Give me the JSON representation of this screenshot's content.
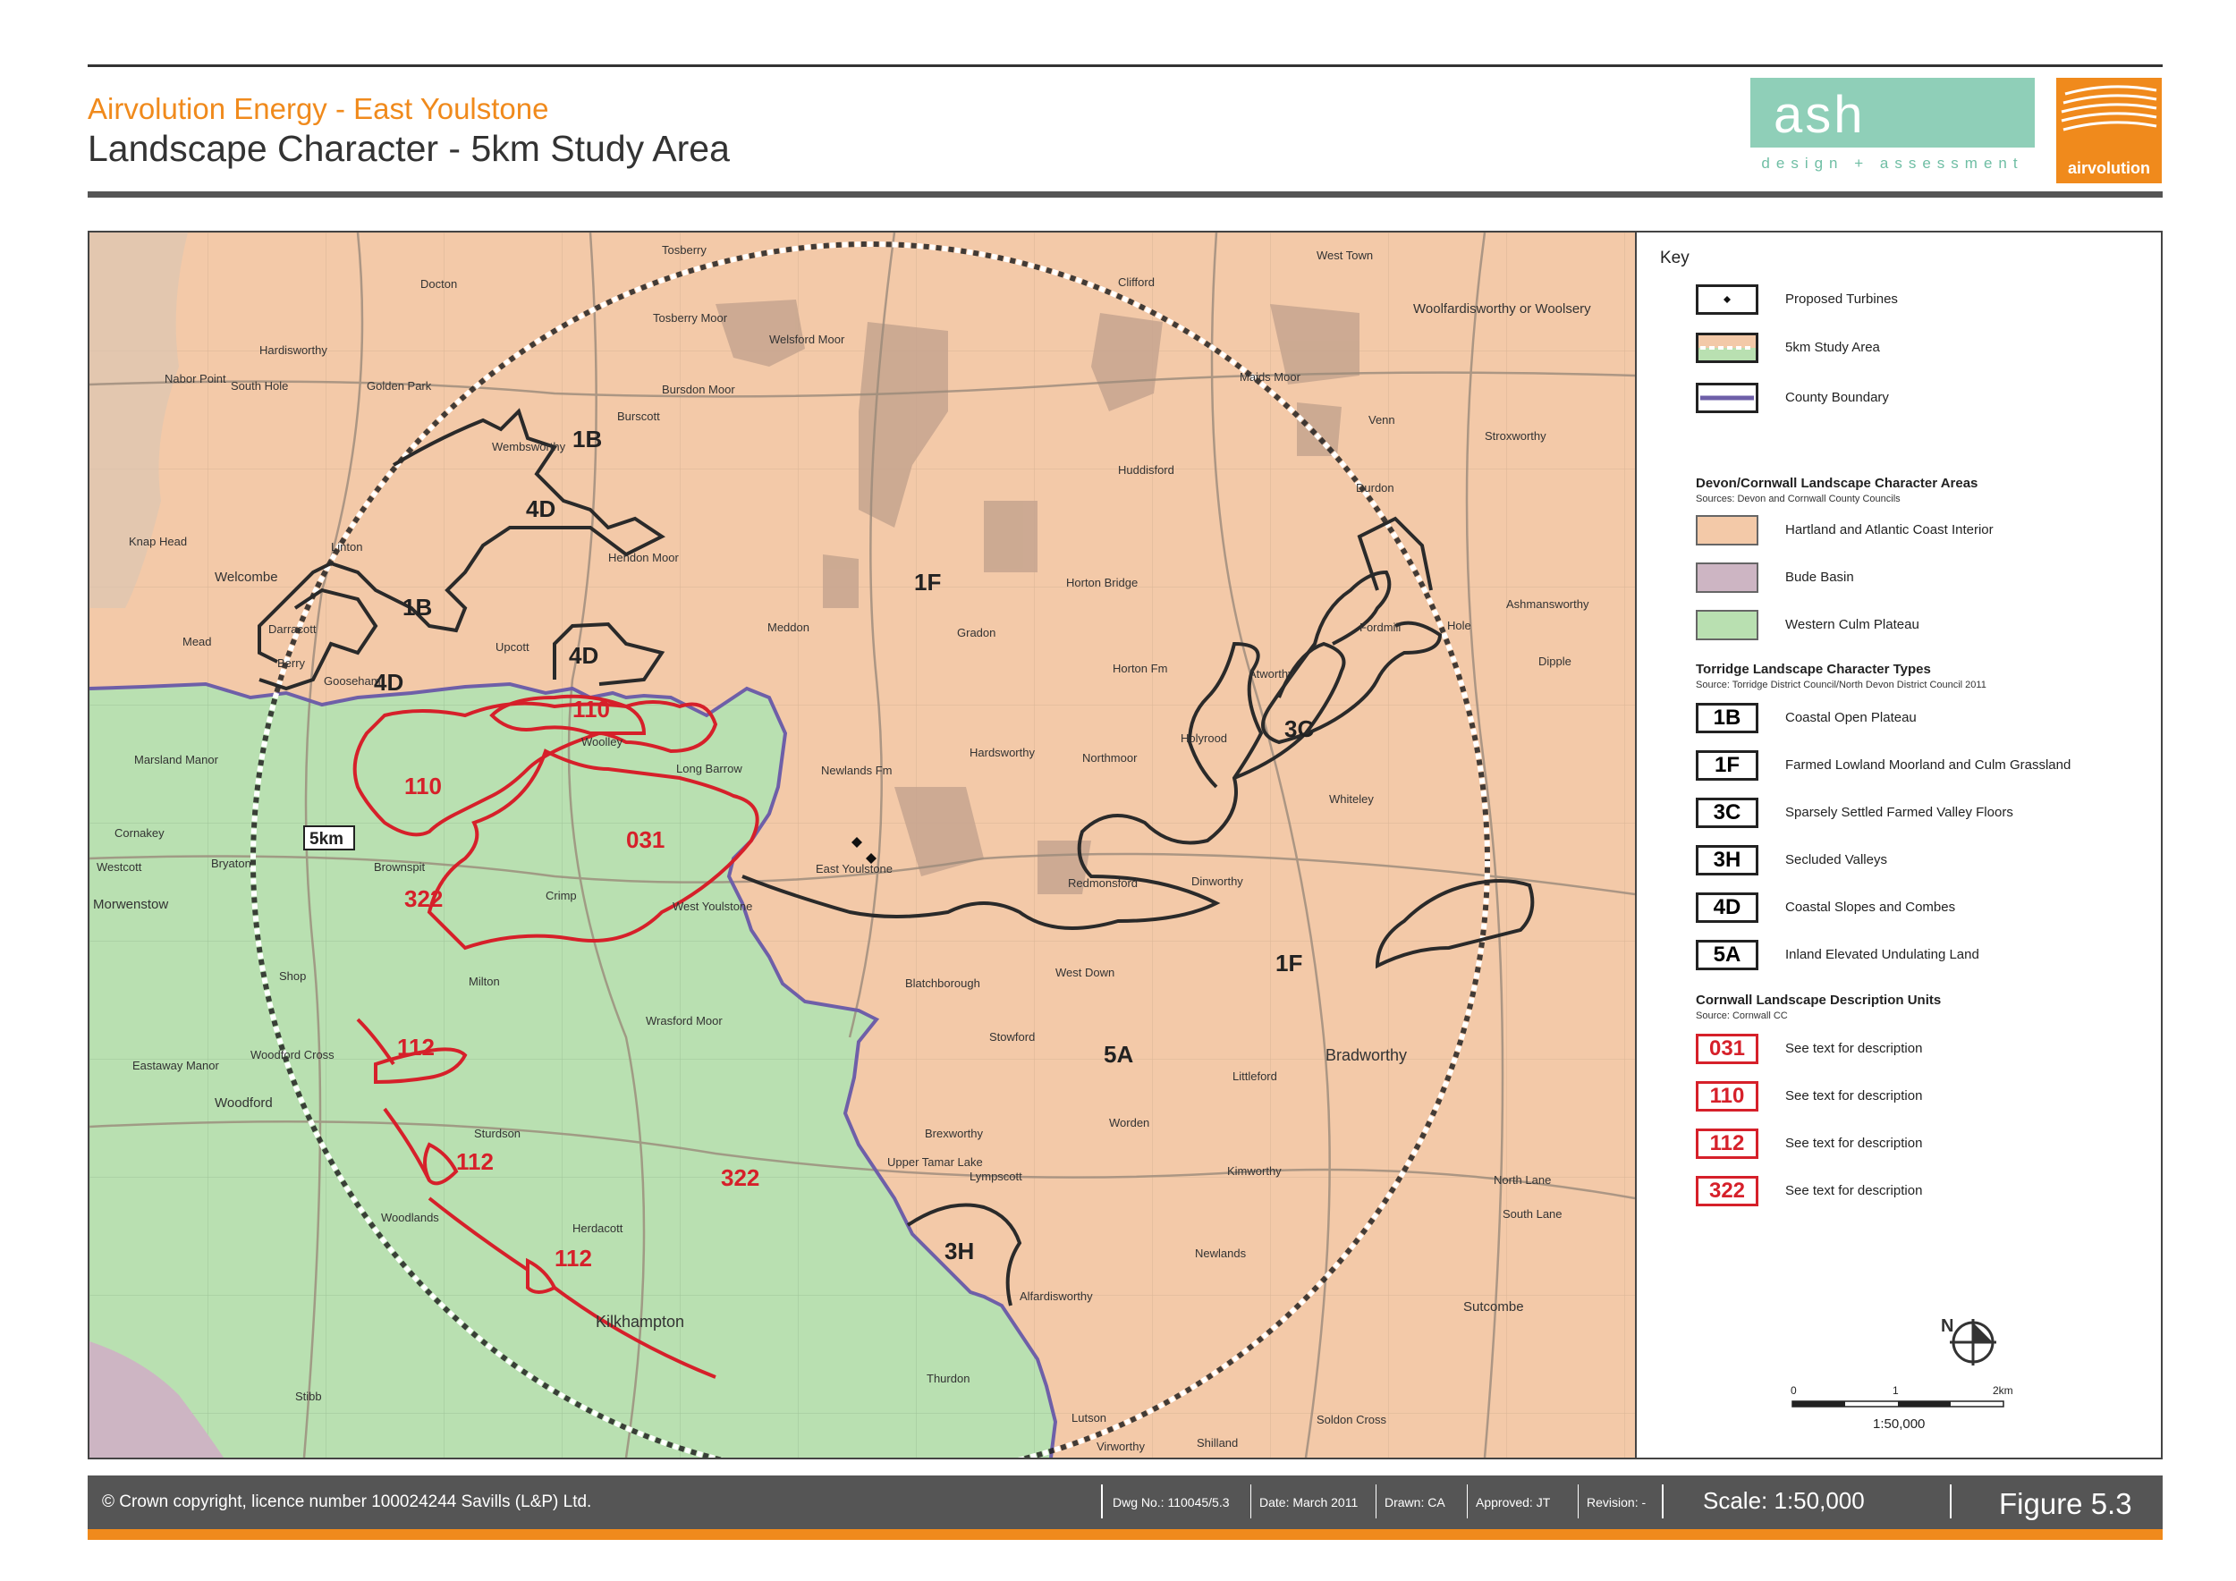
{
  "header": {
    "project": "Airvolution Energy - East Youlstone",
    "title": "Landscape Character - 5km Study Area",
    "logo_ash": "ash",
    "logo_ash_sub": "design + assessment",
    "logo_airvolution": "airvolution"
  },
  "map": {
    "study_area_label": "5km",
    "colors": {
      "hartland": "#f3c9a8",
      "bude": "#cdb5c3",
      "culm": "#b9e0b1",
      "county_boundary": "#6e5fa8",
      "lca_outline": "#222222",
      "cornwall_outline": "#d6202a"
    },
    "lct_labels": [
      "1B",
      "4D",
      "1B",
      "4D",
      "4D",
      "1F",
      "3C",
      "1F",
      "5A",
      "3H"
    ],
    "cornwall_labels": [
      "110",
      "110",
      "031",
      "322",
      "112",
      "112",
      "112",
      "322"
    ],
    "place_names": [
      "Tosberry",
      "Docton",
      "Clifford",
      "West Town",
      "Woolfardisworthy or Woolsery",
      "Hardisworthy",
      "South Hole",
      "Nabor Point",
      "Golden Park",
      "Tosberry Moor",
      "Welsford Moor",
      "Burscott",
      "Bursdon Moor",
      "Wembsworthy",
      "Welcombe",
      "Knap Head",
      "Linton",
      "Hendon Moor",
      "Huddisford",
      "Maids Moor",
      "Durdon",
      "Venn",
      "Stroxworthy",
      "Ashmansworthy",
      "Darracott",
      "Mead",
      "Berry",
      "Upcott",
      "Meddon",
      "Gradon",
      "Horton Bridge",
      "Horton Fm",
      "Atworthy",
      "Fordmill",
      "Hole",
      "Dipple",
      "Gooseham",
      "Woolley",
      "Long Barrow",
      "Marsland Manor",
      "Crimp",
      "West Youlstone",
      "East Youlstone",
      "Newlands Fm",
      "Hardsworthy",
      "Northmoor",
      "Holyrood",
      "Dinworthy",
      "Whiteley",
      "Redmonsford",
      "Bradworthy",
      "Brownspit",
      "Bryaton",
      "Westcott",
      "Milton",
      "Wrasford Moor",
      "Shop",
      "Woodford",
      "Sturdson",
      "Blatchborough",
      "Stowford",
      "West Down",
      "Worden",
      "Littleford",
      "Kimworthy",
      "Brexworthy",
      "Upper Tamar Lake",
      "Lympscott",
      "Alfardisworthy",
      "Newlands",
      "North Lane",
      "South Lane",
      "Sutcombe",
      "Woodlands",
      "Herdacott",
      "Kilkhampton",
      "Thurdon",
      "Stibb",
      "Lutson",
      "Soldon Cross",
      "Virworthy",
      "Shilland",
      "Eastaway Manor",
      "Morwenstow",
      "Cornakey",
      "Woodford Cross"
    ]
  },
  "legend": {
    "key": "Key",
    "basic": [
      {
        "label": "Proposed Turbines"
      },
      {
        "label": "5km Study Area"
      },
      {
        "label": "County Boundary"
      }
    ],
    "devon_cornwall": {
      "heading": "Devon/Cornwall Landscape Character Areas",
      "source": "Sources: Devon and Cornwall County Councils",
      "items": [
        {
          "label": "Hartland and Atlantic Coast Interior",
          "color": "#f3c9a8"
        },
        {
          "label": "Bude Basin",
          "color": "#cdb5c3"
        },
        {
          "label": "Western Culm Plateau",
          "color": "#b9e0b1"
        }
      ]
    },
    "torridge": {
      "heading": "Torridge Landscape Character Types",
      "source": "Source: Torridge District Council/North Devon District Council 2011",
      "items": [
        {
          "code": "1B",
          "label": "Coastal Open Plateau"
        },
        {
          "code": "1F",
          "label": "Farmed Lowland Moorland and Culm Grassland"
        },
        {
          "code": "3C",
          "label": "Sparsely Settled Farmed Valley Floors"
        },
        {
          "code": "3H",
          "label": "Secluded Valleys"
        },
        {
          "code": "4D",
          "label": "Coastal Slopes and Combes"
        },
        {
          "code": "5A",
          "label": "Inland Elevated Undulating Land"
        }
      ]
    },
    "cornwall_units": {
      "heading": "Cornwall  Landscape Description Units",
      "source": "Source: Cornwall CC",
      "items": [
        {
          "code": "031",
          "label": "See text for description"
        },
        {
          "code": "110",
          "label": "See text for description"
        },
        {
          "code": "112",
          "label": "See text for description"
        },
        {
          "code": "322",
          "label": "See text for description"
        }
      ]
    },
    "north": "N",
    "scale_ticks": [
      "0",
      "1",
      "2km"
    ],
    "scale_ratio": "1:50,000"
  },
  "footer": {
    "copyright": "© Crown copyright, licence number 100024244 Savills (L&P) Ltd.",
    "dwg": "Dwg No.: 110045/5.3",
    "date": "Date: March 2011",
    "drawn": "Drawn: CA",
    "approved": "Approved: JT",
    "revision": "Revision: -",
    "scale": "Scale: 1:50,000",
    "figure": "Figure 5.3"
  }
}
